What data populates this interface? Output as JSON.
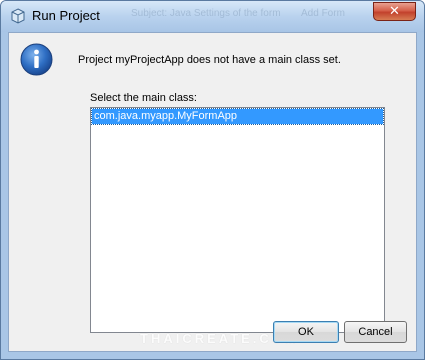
{
  "window": {
    "title": "Run Project",
    "close_label": "✕",
    "ghost_title_left": "Subject: Java Settings of the form",
    "ghost_title_right": "Add Form"
  },
  "dialog": {
    "message": "Project myProjectApp does not have a main class set.",
    "list_label": "Select the main class:",
    "classes": [
      "com.java.myapp.MyFormApp"
    ],
    "selected_index": 0
  },
  "buttons": {
    "ok": "OK",
    "cancel": "Cancel"
  },
  "watermark": "THAICREATE.COM",
  "colors": {
    "selection": "#3399ff",
    "titlebar": "#b9d2ee",
    "close": "#c2412c"
  },
  "icons": {
    "title": "netbeans-cube-icon",
    "info": "information-icon"
  }
}
